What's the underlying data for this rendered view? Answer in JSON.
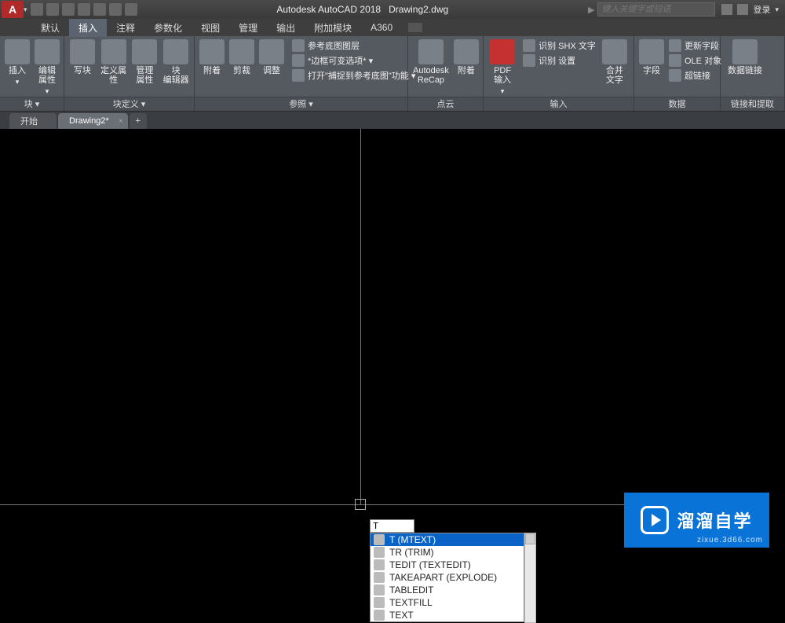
{
  "title": {
    "app": "Autodesk AutoCAD 2018",
    "file": "Drawing2.dwg"
  },
  "search_placeholder": "键入关键字或短语",
  "login_label": "登录",
  "menu_tabs": [
    "默认",
    "插入",
    "注释",
    "参数化",
    "视图",
    "管理",
    "输出",
    "附加模块",
    "A360"
  ],
  "menu_active_index": 1,
  "ribbon": {
    "panels": [
      {
        "title": "块 ▾",
        "big": [
          {
            "label": "插入",
            "name": "insert-block-button"
          },
          {
            "label": "编辑\n属性",
            "name": "edit-attribute-button"
          }
        ],
        "small": []
      },
      {
        "title": "块定义 ▾",
        "big": [
          {
            "label": "写块",
            "name": "write-block-button"
          },
          {
            "label": "定义属性",
            "name": "define-attribute-button"
          },
          {
            "label": "管理\n属性",
            "name": "manage-attribute-button"
          },
          {
            "label": "块\n编辑器",
            "name": "block-editor-button"
          }
        ],
        "small": []
      },
      {
        "title": "",
        "big": [
          {
            "label": "附着",
            "name": "attach-button"
          },
          {
            "label": "剪裁",
            "name": "clip-button"
          },
          {
            "label": "调整",
            "name": "adjust-button"
          }
        ],
        "small": []
      },
      {
        "title": "参照 ▾",
        "big": [],
        "small": [
          {
            "label": "参考底图图层",
            "name": "underlay-layers-row"
          },
          {
            "label": "*边框可变选项* ▾",
            "name": "frame-options-row"
          },
          {
            "label": "打开\"捕捉到参考底图\"功能 ▾",
            "name": "snap-underlay-row"
          }
        ]
      },
      {
        "title": "点云",
        "big": [
          {
            "label": "Autodesk\nReCap",
            "name": "recap-button"
          },
          {
            "label": "附着",
            "name": "attach-pointcloud-button"
          }
        ],
        "small": []
      },
      {
        "title": "输入",
        "big": [
          {
            "label": "PDF\n输入",
            "name": "pdf-import-button"
          }
        ],
        "small": [
          {
            "label": "识别 SHX 文字",
            "name": "recognize-shx-row"
          },
          {
            "label": "识别 设置",
            "name": "recognize-settings-row"
          }
        ],
        "big2": [
          {
            "label": "合并\n文字",
            "name": "merge-text-button"
          }
        ]
      },
      {
        "title": "数据",
        "big": [
          {
            "label": "字段",
            "name": "field-button"
          }
        ],
        "small": [
          {
            "label": "更新字段",
            "name": "update-field-row"
          },
          {
            "label": "OLE 对象",
            "name": "ole-object-row"
          },
          {
            "label": "超链接",
            "name": "hyperlink-row"
          }
        ]
      },
      {
        "title": "链接和提取",
        "big": [
          {
            "label": "数据链接",
            "name": "data-link-button"
          }
        ],
        "small": []
      }
    ]
  },
  "file_tabs": [
    {
      "label": "开始",
      "active": false
    },
    {
      "label": "Drawing2*",
      "active": true
    }
  ],
  "command_input": "T",
  "autocomplete": [
    {
      "label": "T (MTEXT)",
      "selected": true
    },
    {
      "label": "TR (TRIM)",
      "selected": false
    },
    {
      "label": "TEDIT (TEXTEDIT)",
      "selected": false
    },
    {
      "label": "TAKEAPART (EXPLODE)",
      "selected": false
    },
    {
      "label": "TABLEDIT",
      "selected": false
    },
    {
      "label": "TEXTFILL",
      "selected": false
    },
    {
      "label": "TEXT",
      "selected": false
    }
  ],
  "watermark": {
    "brand": "溜溜自学",
    "url": "zixue.3d66.com"
  }
}
